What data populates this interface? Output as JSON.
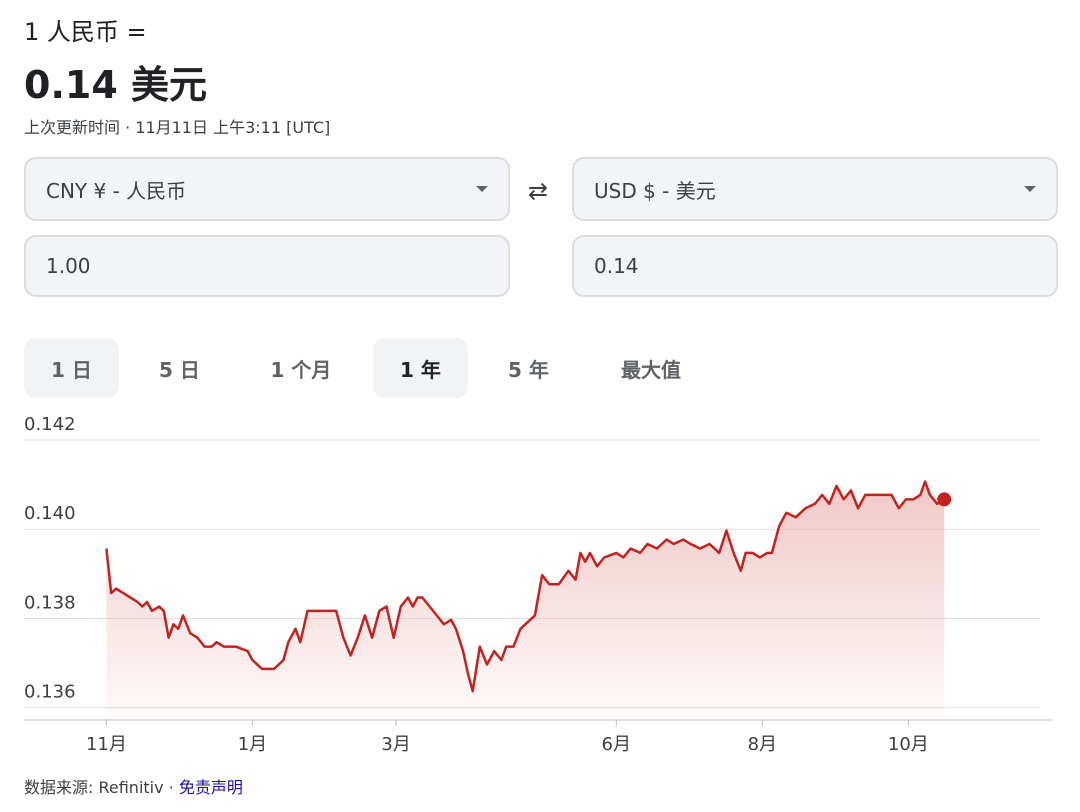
{
  "header": {
    "base_label": "1 人民币 =",
    "converted_value": "0.14 美元",
    "updated_text": "上次更新时间 · 11月11日 上午3:11 [UTC]"
  },
  "converter": {
    "from_currency": "CNY ¥ - 人民币",
    "to_currency": "USD $ - 美元",
    "from_amount": "1.00",
    "to_amount": "0.14",
    "swap_icon": "⇄"
  },
  "range_tabs": [
    {
      "label": "1 日"
    },
    {
      "label": "5 日"
    },
    {
      "label": "1 个月"
    },
    {
      "label": "1 年",
      "selected": true
    },
    {
      "label": "5 年"
    },
    {
      "label": "最大值"
    }
  ],
  "colors": {
    "line": "#c5221f",
    "fill": "#e8aaa8",
    "grid": "#e0e0e0"
  },
  "chart_data": {
    "type": "area",
    "title": "",
    "xlabel": "",
    "ylabel": "",
    "ylim": [
      0.1355,
      0.142
    ],
    "y_ticks": [
      0.142,
      0.14,
      0.138,
      0.136
    ],
    "y_tick_labels": [
      "0.142",
      "0.140",
      "0.138",
      "0.136"
    ],
    "x_ticks": [
      {
        "label": "11月",
        "date": "2023-11-01"
      },
      {
        "label": "1月",
        "date": "2024-01-01"
      },
      {
        "label": "3月",
        "date": "2024-03-01"
      },
      {
        "label": "6月",
        "date": "2024-06-01"
      },
      {
        "label": "8月",
        "date": "2024-08-01"
      },
      {
        "label": "10月",
        "date": "2024-10-01"
      }
    ],
    "x_range": [
      "2023-10-31",
      "2024-11-25"
    ],
    "grid": true,
    "series": [
      {
        "points": [
          [
            "2023-11-01",
            0.1393
          ],
          [
            "2023-11-03",
            0.1383
          ],
          [
            "2023-11-05",
            0.1384
          ],
          [
            "2023-11-08",
            0.1383
          ],
          [
            "2023-11-11",
            0.1382
          ],
          [
            "2023-11-14",
            0.1381
          ],
          [
            "2023-11-16",
            0.138
          ],
          [
            "2023-11-18",
            0.1381
          ],
          [
            "2023-11-20",
            0.1379
          ],
          [
            "2023-11-23",
            0.138
          ],
          [
            "2023-11-25",
            0.1379
          ],
          [
            "2023-11-27",
            0.1373
          ],
          [
            "2023-11-29",
            0.1376
          ],
          [
            "2023-12-01",
            0.1375
          ],
          [
            "2023-12-03",
            0.1378
          ],
          [
            "2023-12-06",
            0.1374
          ],
          [
            "2023-12-09",
            0.1373
          ],
          [
            "2023-12-12",
            0.1371
          ],
          [
            "2023-12-15",
            0.1371
          ],
          [
            "2023-12-17",
            0.1372
          ],
          [
            "2023-12-20",
            0.1371
          ],
          [
            "2023-12-25",
            0.1371
          ],
          [
            "2023-12-30",
            0.137
          ],
          [
            "2024-01-01",
            0.1368
          ],
          [
            "2024-01-05",
            0.1366
          ],
          [
            "2024-01-10",
            0.1366
          ],
          [
            "2024-01-14",
            0.1368
          ],
          [
            "2024-01-16",
            0.1372
          ],
          [
            "2024-01-19",
            0.1375
          ],
          [
            "2024-01-21",
            0.1372
          ],
          [
            "2024-01-24",
            0.1379
          ],
          [
            "2024-01-28",
            0.1379
          ],
          [
            "2024-02-01",
            0.1379
          ],
          [
            "2024-02-05",
            0.1379
          ],
          [
            "2024-02-08",
            0.1373
          ],
          [
            "2024-02-11",
            0.1369
          ],
          [
            "2024-02-14",
            0.1373
          ],
          [
            "2024-02-17",
            0.1378
          ],
          [
            "2024-02-20",
            0.1373
          ],
          [
            "2024-02-23",
            0.1379
          ],
          [
            "2024-02-26",
            0.138
          ],
          [
            "2024-02-29",
            0.1373
          ],
          [
            "2024-03-03",
            0.138
          ],
          [
            "2024-03-06",
            0.1382
          ],
          [
            "2024-03-08",
            0.138
          ],
          [
            "2024-03-10",
            0.1382
          ],
          [
            "2024-03-12",
            0.1382
          ],
          [
            "2024-03-15",
            0.138
          ],
          [
            "2024-03-18",
            0.1378
          ],
          [
            "2024-03-21",
            0.1376
          ],
          [
            "2024-03-24",
            0.1377
          ],
          [
            "2024-03-26",
            0.1375
          ],
          [
            "2024-03-29",
            0.137
          ],
          [
            "2024-03-31",
            0.1365
          ],
          [
            "2024-04-02",
            0.1361
          ],
          [
            "2024-04-05",
            0.1371
          ],
          [
            "2024-04-08",
            0.1367
          ],
          [
            "2024-04-11",
            0.137
          ],
          [
            "2024-04-14",
            0.1368
          ],
          [
            "2024-04-16",
            0.1371
          ],
          [
            "2024-04-19",
            0.1371
          ],
          [
            "2024-04-22",
            0.1375
          ],
          [
            "2024-04-24",
            0.1376
          ],
          [
            "2024-04-28",
            0.1378
          ],
          [
            "2024-05-01",
            0.1387
          ],
          [
            "2024-05-04",
            0.1385
          ],
          [
            "2024-05-08",
            0.1385
          ],
          [
            "2024-05-12",
            0.1388
          ],
          [
            "2024-05-15",
            0.1386
          ],
          [
            "2024-05-17",
            0.1392
          ],
          [
            "2024-05-19",
            0.139
          ],
          [
            "2024-05-21",
            0.1392
          ],
          [
            "2024-05-24",
            0.1389
          ],
          [
            "2024-05-27",
            0.1391
          ],
          [
            "2024-06-01",
            0.1392
          ],
          [
            "2024-06-04",
            0.1391
          ],
          [
            "2024-06-07",
            0.1393
          ],
          [
            "2024-06-11",
            0.1392
          ],
          [
            "2024-06-14",
            0.1394
          ],
          [
            "2024-06-18",
            0.1393
          ],
          [
            "2024-06-22",
            0.1395
          ],
          [
            "2024-06-25",
            0.1394
          ],
          [
            "2024-06-29",
            0.1395
          ],
          [
            "2024-07-02",
            0.1394
          ],
          [
            "2024-07-06",
            0.1393
          ],
          [
            "2024-07-10",
            0.1394
          ],
          [
            "2024-07-14",
            0.1392
          ],
          [
            "2024-07-17",
            0.1397
          ],
          [
            "2024-07-20",
            0.1392
          ],
          [
            "2024-07-23",
            0.1388
          ],
          [
            "2024-07-25",
            0.1392
          ],
          [
            "2024-07-28",
            0.1392
          ],
          [
            "2024-07-31",
            0.1391
          ],
          [
            "2024-08-03",
            0.1392
          ],
          [
            "2024-08-05",
            0.1392
          ],
          [
            "2024-08-08",
            0.1398
          ],
          [
            "2024-08-11",
            0.1401
          ],
          [
            "2024-08-15",
            0.14
          ],
          [
            "2024-08-19",
            0.1402
          ],
          [
            "2024-08-23",
            0.1403
          ],
          [
            "2024-08-26",
            0.1405
          ],
          [
            "2024-08-29",
            0.1403
          ],
          [
            "2024-09-01",
            0.1407
          ],
          [
            "2024-09-04",
            0.1404
          ],
          [
            "2024-09-07",
            0.1406
          ],
          [
            "2024-09-10",
            0.1402
          ],
          [
            "2024-09-13",
            0.1405
          ],
          [
            "2024-09-20",
            0.1405
          ],
          [
            "2024-09-24",
            0.1405
          ],
          [
            "2024-09-27",
            0.1402
          ],
          [
            "2024-09-30",
            0.1404
          ],
          [
            "2024-10-03",
            0.1404
          ],
          [
            "2024-10-06",
            0.1405
          ],
          [
            "2024-10-08",
            0.1408
          ],
          [
            "2024-10-10",
            0.1405
          ],
          [
            "2024-10-13",
            0.1403
          ],
          [
            "2024-10-16",
            0.1404
          ]
        ]
      }
    ]
  },
  "footer": {
    "source_text": "数据来源: Refinitiv · ",
    "disclaimer_link": "免责声明"
  }
}
